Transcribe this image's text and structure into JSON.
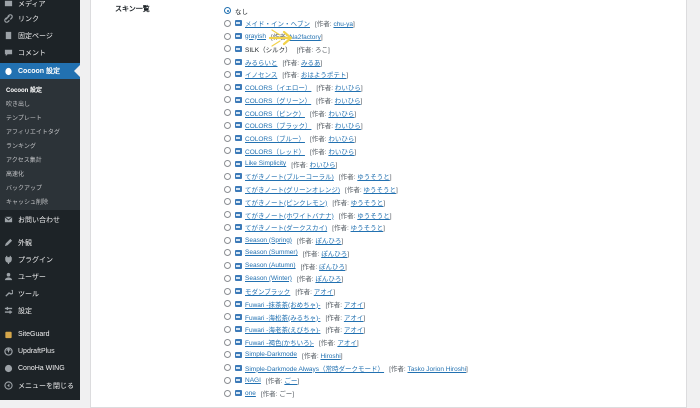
{
  "sidebar": {
    "top_items": [
      {
        "label": "メディア",
        "icon": "media-icon"
      },
      {
        "label": "リンク",
        "icon": "link-icon"
      },
      {
        "label": "固定ページ",
        "icon": "page-icon"
      },
      {
        "label": "コメント",
        "icon": "comment-icon"
      },
      {
        "label": "Cocoon 設定",
        "icon": "cocoon-icon"
      }
    ],
    "submenu": [
      "Cocoon 設定",
      "吹き出し",
      "テンプレート",
      "アフィリエイトタグ",
      "ランキング",
      "アクセス集計",
      "高速化",
      "バックアップ",
      "キャッシュ削除"
    ],
    "items": [
      {
        "label": "お問い合わせ",
        "icon": "mail-icon"
      },
      {
        "label": "外観",
        "icon": "appearance-icon"
      },
      {
        "label": "プラグイン",
        "icon": "plugin-icon"
      },
      {
        "label": "ユーザー",
        "icon": "user-icon"
      },
      {
        "label": "ツール",
        "icon": "tools-icon"
      },
      {
        "label": "設定",
        "icon": "settings-icon"
      },
      {
        "label": "SiteGuard",
        "icon": "siteguard-icon"
      },
      {
        "label": "UpdraftPlus",
        "icon": "updraftplus-icon"
      },
      {
        "label": "ConoHa WING",
        "icon": "conoha-icon"
      },
      {
        "label": "メニューを閉じる",
        "icon": "collapse-icon"
      }
    ]
  },
  "main": {
    "skin_list_label": "スキン一覧",
    "author_prefix": "[作者:",
    "author_suffix": "]",
    "skins": [
      {
        "name": "なし",
        "selected": true,
        "link": false,
        "image": false
      },
      {
        "name": "メイド・イン・ヘブン",
        "author": "chu-ya",
        "link": true,
        "image": true
      },
      {
        "name": "grayish",
        "author": "Na2factory",
        "link": true,
        "image": true
      },
      {
        "name": "SILK（シルク）",
        "author": "ろこ",
        "link": false,
        "image": true,
        "author_link": false
      },
      {
        "name": "みるらいと",
        "author": "みるあ",
        "link": true,
        "image": true
      },
      {
        "name": "イノセンス",
        "author": "おはようポテト",
        "link": true,
        "image": true
      },
      {
        "name": "COLORS（イエロー）",
        "author": "わいひら",
        "link": true,
        "image": true
      },
      {
        "name": "COLORS（グリーン）",
        "author": "わいひら",
        "link": true,
        "image": true
      },
      {
        "name": "COLORS（ピンク）",
        "author": "わいひら",
        "link": true,
        "image": true
      },
      {
        "name": "COLORS（ブラック）",
        "author": "わいひら",
        "link": true,
        "image": true
      },
      {
        "name": "COLORS（ブルー）",
        "author": "わいひら",
        "link": true,
        "image": true
      },
      {
        "name": "COLORS（レッド）",
        "author": "わいひら",
        "link": true,
        "image": true
      },
      {
        "name": "Like Simplicity",
        "author": "わいひら",
        "link": true,
        "image": true
      },
      {
        "name": "てがきノート(ブルーコーラル)",
        "author": "ゆうそうと",
        "link": true,
        "image": true
      },
      {
        "name": "てがきノート(グリーンオレンジ)",
        "author": "ゆうそうと",
        "link": true,
        "image": true
      },
      {
        "name": "てがきノート(ピンクレモン)",
        "author": "ゆうそうと",
        "link": true,
        "image": true
      },
      {
        "name": "てがきノート(ホワイトバナナ)",
        "author": "ゆうそうと",
        "link": true,
        "image": true
      },
      {
        "name": "てがきノート(ダークスカイ)",
        "author": "ゆうそうと",
        "link": true,
        "image": true
      },
      {
        "name": "Season (Spring)",
        "author": "ぽんひろ",
        "link": true,
        "image": true
      },
      {
        "name": "Season (Summer)",
        "author": "ぽんひろ",
        "link": true,
        "image": true
      },
      {
        "name": "Season (Autumn)",
        "author": "ぽんひろ",
        "link": true,
        "image": true
      },
      {
        "name": "Season (Winter)",
        "author": "ぽんひろ",
        "link": true,
        "image": true
      },
      {
        "name": "モダンブラック",
        "author": "アオイ",
        "link": true,
        "image": true
      },
      {
        "name": "Fuwari -抹茶茶(おめちゃ)-",
        "author": "アオイ",
        "link": true,
        "image": true
      },
      {
        "name": "Fuwari -海松茶(みるちゃ)-",
        "author": "アオイ",
        "link": true,
        "image": true
      },
      {
        "name": "Fuwari -海老茶(えびちゃ)-",
        "author": "アオイ",
        "link": true,
        "image": true
      },
      {
        "name": "Fuwari -褐色(かちいろ)-",
        "author": "アオイ",
        "link": true,
        "image": true
      },
      {
        "name": "Simple-Darkmode",
        "author": "Hiroshi",
        "link": true,
        "image": true
      },
      {
        "name": "Simple-Darkmode Always（常時ダークモード）",
        "author": "Tasko Jorion Hiroshi",
        "link": true,
        "image": true
      },
      {
        "name": "NAGI",
        "author": "ごー",
        "link": true,
        "image": true
      },
      {
        "name": "one",
        "author": "ごー",
        "link": true,
        "image": true,
        "author_link": false
      }
    ]
  },
  "colors": {
    "sidebar_bg": "#1d2327",
    "accent": "#2271b1",
    "hint_arrow": "#f2d24a"
  }
}
